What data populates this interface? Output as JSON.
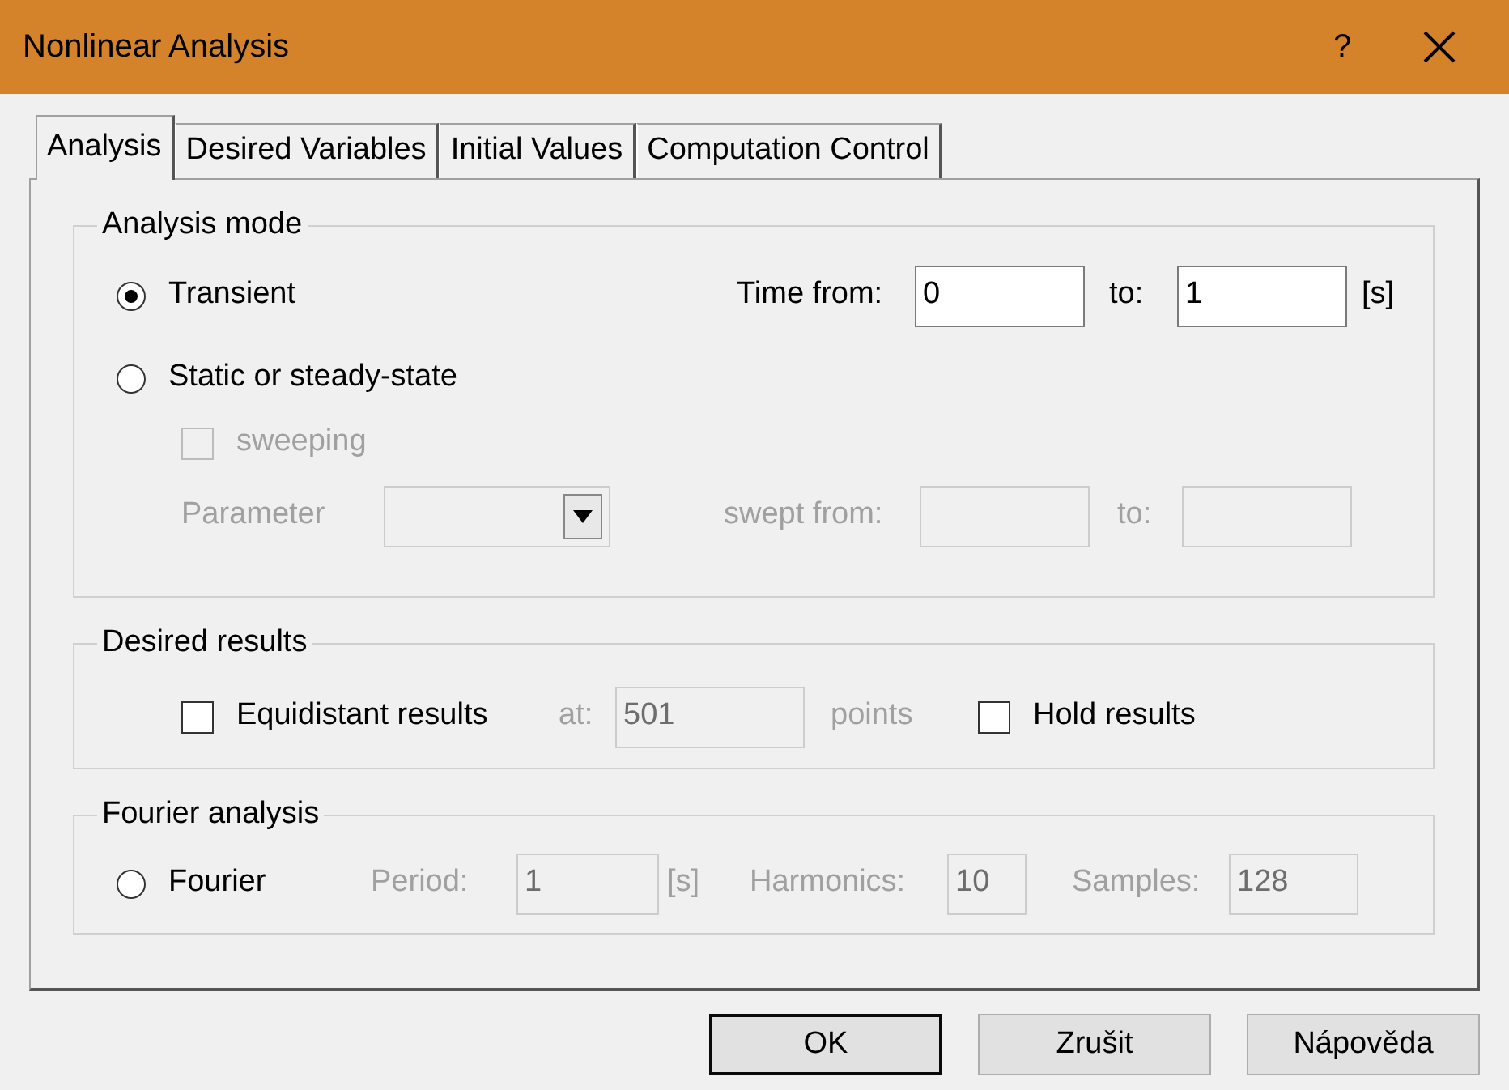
{
  "window": {
    "title": "Nonlinear Analysis",
    "help": "?"
  },
  "tabs": [
    {
      "label": "Analysis",
      "selected": true
    },
    {
      "label": "Desired Variables",
      "selected": false
    },
    {
      "label": "Initial Values",
      "selected": false
    },
    {
      "label": "Computation Control",
      "selected": false
    }
  ],
  "analysis_mode": {
    "title": "Analysis mode",
    "modes": [
      {
        "label": "Transient",
        "selected": true
      },
      {
        "label": "Static or steady-state",
        "selected": false
      }
    ],
    "time_from": {
      "label": "Time from:",
      "value": "0",
      "disabled": false
    },
    "time_to": {
      "label": "to:",
      "value": "1",
      "disabled": false
    },
    "time_unit": "[s]",
    "sweeping": {
      "label": "sweeping",
      "checked": false,
      "disabled": true
    },
    "parameter": {
      "label": "Parameter",
      "disabled": true
    },
    "swept_from": {
      "label": "swept from:",
      "disabled": true
    },
    "swept_to": {
      "label": "to:",
      "disabled": true
    }
  },
  "desired_results": {
    "title": "Desired results",
    "equidistant": {
      "label": "Equidistant results",
      "checked": false,
      "disabled": false
    },
    "points": {
      "label": "at:",
      "value": "501",
      "unit": "points",
      "disabled": true
    },
    "hold": {
      "label": "Hold results",
      "checked": false,
      "disabled": false
    }
  },
  "fourier_analysis": {
    "title": "Fourier analysis",
    "fourier": {
      "label": "Fourier",
      "selected": false
    },
    "period": {
      "label": "Period:",
      "value": "1",
      "unit": "[s]",
      "disabled": true
    },
    "harmonics": {
      "label": "Harmonics:",
      "value": "10",
      "disabled": true
    },
    "samples": {
      "label": "Samples:",
      "value": "128",
      "disabled": true
    }
  },
  "buttons": [
    {
      "label": "OK",
      "default": true
    },
    {
      "label": "Zrušit",
      "default": false
    },
    {
      "label": "Nápověda",
      "default": false
    }
  ]
}
